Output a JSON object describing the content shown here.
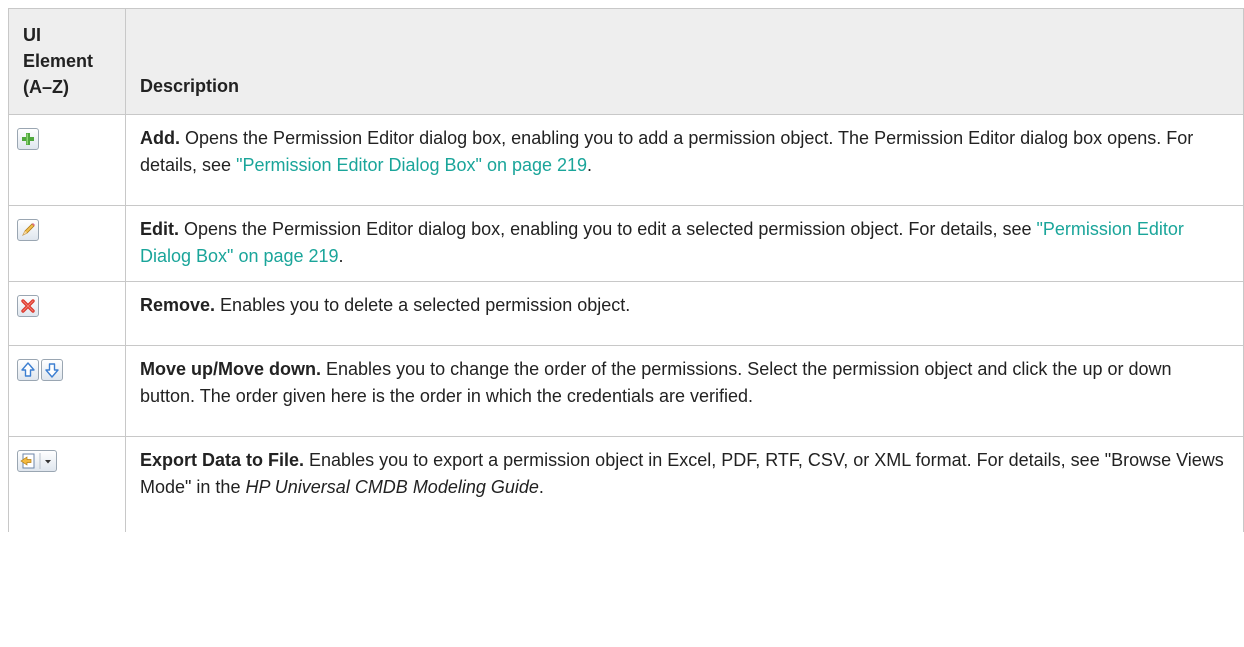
{
  "header": {
    "col_element_line1": "UI",
    "col_element_line2": "Element",
    "col_element_line3": "(A–Z)",
    "col_description": "Description"
  },
  "rows": [
    {
      "icon": "add-icon",
      "title": "Add.",
      "text": " Opens the Permission Editor dialog box, enabling you to add a permission object. The Permission Editor dialog box opens. For details, see ",
      "link": "\"Permission Editor Dialog Box\" on page 219",
      "after": "."
    },
    {
      "icon": "edit-pencil-icon",
      "title": "Edit.",
      "text": " Opens the Permission Editor dialog box, enabling you to edit a selected permission object. For details, see ",
      "link": "\"Permission Editor Dialog Box\" on page 219",
      "after": "."
    },
    {
      "icon": "remove-x-icon",
      "title": "Remove.",
      "text": " Enables you to delete a selected permission object."
    },
    {
      "icon": "move-up-down-icons",
      "title": "Move up/Move down.",
      "text": " Enables you to change the order of the permissions. Select the permission object and click the up or down button. The order given here is the order in which the credentials are verified."
    },
    {
      "icon": "export-data-icon",
      "title": "Export Data to File.",
      "text": " Enables you to export a permission object in Excel, PDF, RTF, CSV, or XML format. For details, see \"Browse Views Mode\" in the ",
      "italic": "HP Universal CMDB Modeling Guide",
      "after": "."
    }
  ]
}
